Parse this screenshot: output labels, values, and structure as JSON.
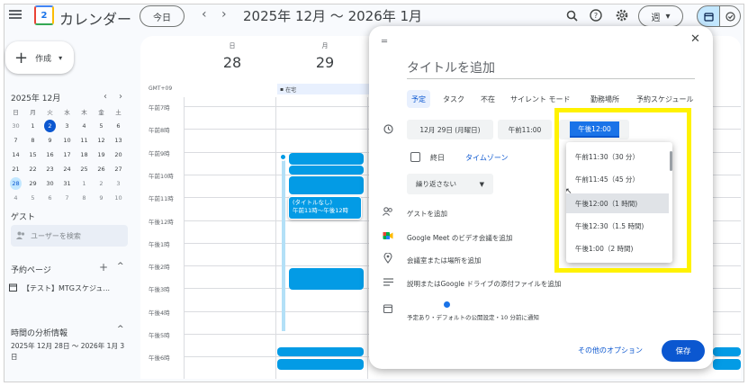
{
  "header": {
    "app_title": "カレンダー",
    "logo_text": "2",
    "today_button": "今日",
    "date_range": "2025年 12月 〜 2026年 1月",
    "view_select": "週",
    "icons": [
      "menu-icon",
      "search-icon",
      "help-icon",
      "settings-icon",
      "calendar-view-icon",
      "tasks-view-icon"
    ]
  },
  "sidebar": {
    "create_label": "作成",
    "mini_calendar": {
      "title": "2025年 12月",
      "weekday_headers": [
        "日",
        "月",
        "火",
        "水",
        "木",
        "金",
        "土"
      ],
      "weeks": [
        [
          "30",
          "1",
          "2",
          "3",
          "4",
          "5",
          "6"
        ],
        [
          "7",
          "8",
          "9",
          "10",
          "11",
          "12",
          "13"
        ],
        [
          "14",
          "15",
          "16",
          "17",
          "18",
          "19",
          "20"
        ],
        [
          "21",
          "22",
          "23",
          "24",
          "25",
          "26",
          "27"
        ],
        [
          "28",
          "29",
          "30",
          "31",
          "1",
          "2",
          "3"
        ],
        [
          "4",
          "5",
          "6",
          "7",
          "8",
          "9",
          "10"
        ]
      ],
      "today": "2",
      "selected": "28"
    },
    "guest_label": "ゲスト",
    "user_search_placeholder": "ユーザーを検索",
    "booking_title": "予約ページ",
    "booking_item": "【テスト】MTGスケジュ...",
    "analytics_title": "時間の分析情報",
    "analytics_range": "2025年 12月 28日 〜 2026年 1月 3日"
  },
  "calendar": {
    "days": [
      {
        "dow": "日",
        "num": "28"
      },
      {
        "dow": "月",
        "num": "29"
      }
    ],
    "gmt_label": "GMT+09",
    "allday_event": "在宅",
    "time_labels": [
      "午前7時",
      "午前8時",
      "午前9時",
      "午前10時",
      "午前11時",
      "午後12時",
      "午後1時",
      "午後2時",
      "午後3時",
      "午後4時",
      "午後5時",
      "午後6時"
    ],
    "focus_event": {
      "title": "(タイトルなし)",
      "time": "午前11時〜午後12時"
    }
  },
  "dialog": {
    "title_placeholder": "タイトルを追加",
    "tabs": [
      "予定",
      "タスク",
      "不在",
      "サイレント モード",
      "勤務場所",
      "予約スケジュール"
    ],
    "active_tab": "予定",
    "date_chip": "12月 29日 (月曜日)",
    "start_time": "午前11:00",
    "end_time": "午後12:00",
    "allday_label": "終日",
    "timezone_link": "タイムゾーン",
    "repeat_label": "繰り返さない",
    "add_guests": "ゲストを追加",
    "meet_label": "Google Meet のビデオ会議を追加",
    "room_label": "会議室または場所を追加",
    "description_label": "説明またはGoogle ドライブの添付ファイルを追加",
    "visibility_label": "予定あり・デフォルトの公開設定・10 分前に通知",
    "more_options": "その他のオプション",
    "save_button": "保存"
  },
  "end_time_dropdown": {
    "options": [
      {
        "label": "午前11:30（30 分）"
      },
      {
        "label": "午前11:45（45 分）"
      },
      {
        "label": "午後12:00（1 時間)"
      },
      {
        "label": "午後12:30（1.5 時間)"
      },
      {
        "label": "午後1:00（2 時間)"
      }
    ],
    "hovered_index": 2
  },
  "colors": {
    "event_blue": "#039be5",
    "primary_blue": "#0b57d0",
    "highlight_yellow": "#fff200"
  }
}
